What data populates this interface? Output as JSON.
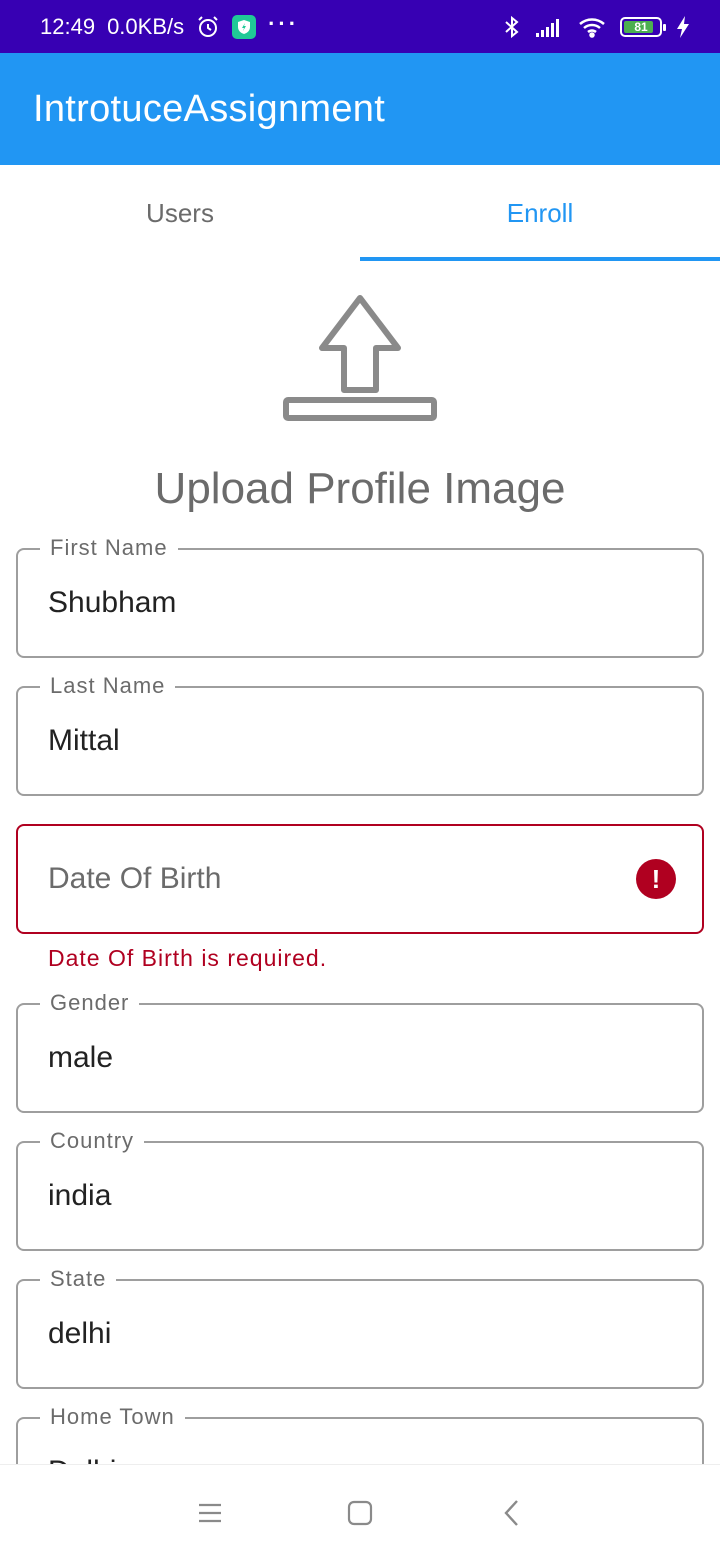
{
  "status_bar": {
    "time": "12:49",
    "net_speed": "0.0KB/s",
    "icons": [
      "alarm-icon",
      "shield-icon",
      "more-dots-icon",
      "bluetooth-icon",
      "signal-icon",
      "wifi-icon",
      "battery-icon",
      "charging-icon"
    ],
    "more": "···",
    "battery_level": "81"
  },
  "app_bar": {
    "title": "IntrotuceAssignment"
  },
  "tabs": [
    {
      "label": "Users",
      "active": false
    },
    {
      "label": "Enroll",
      "active": true
    }
  ],
  "upload": {
    "label": "Upload Profile Image",
    "icon": "upload-icon"
  },
  "form": {
    "first_name": {
      "label": "First Name",
      "value": "Shubham"
    },
    "last_name": {
      "label": "Last Name",
      "value": "Mittal"
    },
    "dob": {
      "placeholder": "Date Of Birth",
      "error": "Date Of Birth is required.",
      "error_icon": "!"
    },
    "gender": {
      "label": "Gender",
      "value": "male"
    },
    "country": {
      "label": "Country",
      "value": "india"
    },
    "state": {
      "label": "State",
      "value": "delhi"
    },
    "home_town": {
      "label": "Home Town",
      "value": "Delhi"
    }
  },
  "nav_bar": {
    "icons": [
      "menu-icon",
      "home-square-icon",
      "back-icon"
    ]
  },
  "colors": {
    "primary": "#2196f3",
    "status_bar": "#3700b3",
    "error": "#b00020",
    "text_secondary": "#6b6b6b"
  }
}
